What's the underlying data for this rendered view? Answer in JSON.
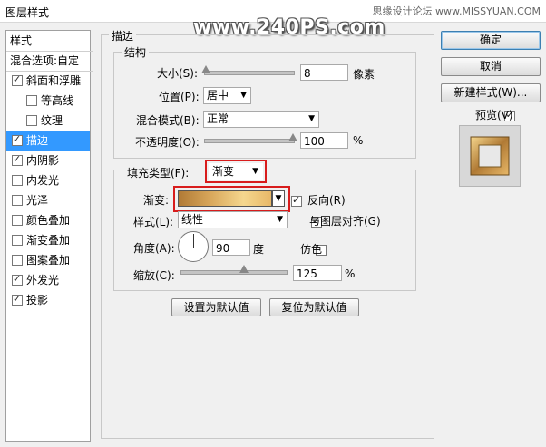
{
  "window": {
    "title": "图层样式",
    "watermark_right": "思缘设计论坛 www.MISSYUAN.COM",
    "watermark_center": "www.240PS.com"
  },
  "sidebar": {
    "items": [
      {
        "label": "样式",
        "checkbox": false,
        "header": true
      },
      {
        "label": "混合选项:自定",
        "checkbox": false,
        "header": true
      },
      {
        "label": "斜面和浮雕",
        "checkbox": true,
        "checked": true
      },
      {
        "label": "等高线",
        "checkbox": true,
        "checked": false,
        "indent": true
      },
      {
        "label": "纹理",
        "checkbox": true,
        "checked": false,
        "indent": true
      },
      {
        "label": "描边",
        "checkbox": true,
        "checked": true,
        "selected": true
      },
      {
        "label": "内阴影",
        "checkbox": true,
        "checked": true
      },
      {
        "label": "内发光",
        "checkbox": true,
        "checked": false
      },
      {
        "label": "光泽",
        "checkbox": true,
        "checked": false
      },
      {
        "label": "颜色叠加",
        "checkbox": true,
        "checked": false
      },
      {
        "label": "渐变叠加",
        "checkbox": true,
        "checked": false
      },
      {
        "label": "图案叠加",
        "checkbox": true,
        "checked": false
      },
      {
        "label": "外发光",
        "checkbox": true,
        "checked": true
      },
      {
        "label": "投影",
        "checkbox": true,
        "checked": true
      }
    ]
  },
  "stroke": {
    "section_title": "描边",
    "structure_title": "结构",
    "size_label": "大小(S):",
    "size_value": "8",
    "size_unit": "像素",
    "size_slider_fraction": 0.02,
    "position_label": "位置(P):",
    "position_value": "居中",
    "blend_label": "混合模式(B):",
    "blend_value": "正常",
    "opacity_label": "不透明度(O):",
    "opacity_value": "100",
    "opacity_unit": "%",
    "opacity_slider_fraction": 1.0,
    "fill_type_label": "填充类型(F):",
    "fill_type_value": "渐变",
    "gradient_label": "渐变:",
    "reverse_label": "反向(R)",
    "reverse_checked": true,
    "style_label": "样式(L):",
    "style_value": "线性",
    "align_label": "与图层对齐(G)",
    "align_checked": true,
    "angle_label": "角度(A):",
    "angle_value": "90",
    "angle_unit": "度",
    "dither_label": "仿色",
    "dither_checked": false,
    "scale_label": "缩放(C):",
    "scale_value": "125",
    "scale_unit": "%",
    "scale_slider_fraction": 0.6,
    "set_default_label": "设置为默认值",
    "reset_default_label": "复位为默认值"
  },
  "buttons": {
    "ok": "确定",
    "cancel": "取消",
    "new_style": "新建样式(W)...",
    "preview_label": "预览(V)",
    "preview_checked": true
  },
  "colors": {
    "selection": "#3399ff",
    "highlight_box": "#d81c1c",
    "gold_light": "#f5d78e",
    "gold_dark": "#b07a35"
  }
}
